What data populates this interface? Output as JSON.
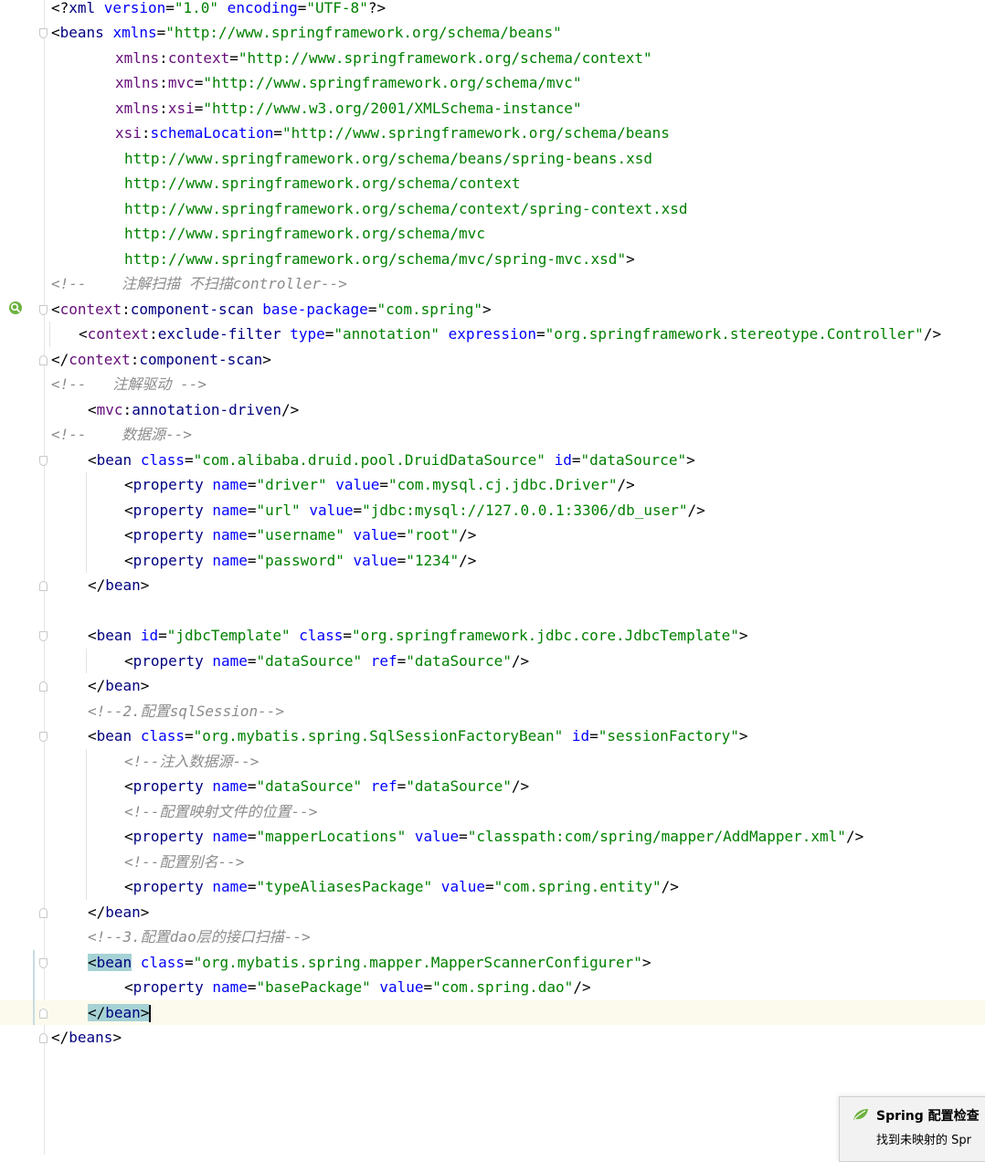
{
  "editor": {
    "language": "xml",
    "lines": [
      {
        "indent": 0,
        "fold": "",
        "tokens": [
          [
            "bracket",
            "<?"
          ],
          [
            "tag",
            "xml "
          ],
          [
            "attr",
            "version"
          ],
          [
            "eq",
            "="
          ],
          [
            "val",
            "\"1.0\""
          ],
          [
            "attr",
            " encoding"
          ],
          [
            "eq",
            "="
          ],
          [
            "val",
            "\"UTF-8\""
          ],
          [
            "bracket",
            "?>"
          ]
        ]
      },
      {
        "indent": 0,
        "fold": "open",
        "tokens": [
          [
            "bracket",
            "<"
          ],
          [
            "tag",
            "beans "
          ],
          [
            "attr",
            "xmlns"
          ],
          [
            "eq",
            "="
          ],
          [
            "val",
            "\"http://www.springframework.org/schema/beans\""
          ]
        ]
      },
      {
        "indent": 7,
        "fold": "",
        "tokens": [
          [
            "ns",
            "xmlns"
          ],
          [
            "eq",
            ":"
          ],
          [
            "ns",
            "context"
          ],
          [
            "eq",
            "="
          ],
          [
            "val",
            "\"http://www.springframework.org/schema/context\""
          ]
        ]
      },
      {
        "indent": 7,
        "fold": "",
        "tokens": [
          [
            "ns",
            "xmlns"
          ],
          [
            "eq",
            ":"
          ],
          [
            "ns",
            "mvc"
          ],
          [
            "eq",
            "="
          ],
          [
            "val",
            "\"http://www.springframework.org/schema/mvc\""
          ]
        ]
      },
      {
        "indent": 7,
        "fold": "",
        "tokens": [
          [
            "ns",
            "xmlns"
          ],
          [
            "eq",
            ":"
          ],
          [
            "ns",
            "xsi"
          ],
          [
            "eq",
            "="
          ],
          [
            "val",
            "\"http://www.w3.org/2001/XMLSchema-instance\""
          ]
        ]
      },
      {
        "indent": 7,
        "fold": "",
        "tokens": [
          [
            "ns",
            "xsi"
          ],
          [
            "eq",
            ":"
          ],
          [
            "attr",
            "schemaLocation"
          ],
          [
            "eq",
            "="
          ],
          [
            "val",
            "\"http://www.springframework.org/schema/beans"
          ]
        ]
      },
      {
        "indent": 8,
        "fold": "",
        "tokens": [
          [
            "val",
            "http://www.springframework.org/schema/beans/spring-beans.xsd"
          ]
        ]
      },
      {
        "indent": 8,
        "fold": "",
        "tokens": [
          [
            "val",
            "http://www.springframework.org/schema/context"
          ]
        ]
      },
      {
        "indent": 8,
        "fold": "",
        "tokens": [
          [
            "val",
            "http://www.springframework.org/schema/context/spring-context.xsd"
          ]
        ]
      },
      {
        "indent": 8,
        "fold": "",
        "tokens": [
          [
            "val",
            "http://www.springframework.org/schema/mvc"
          ]
        ]
      },
      {
        "indent": 8,
        "fold": "",
        "tokens": [
          [
            "val",
            "http://www.springframework.org/schema/mvc/spring-mvc.xsd\""
          ],
          [
            "bracket",
            ">"
          ]
        ]
      },
      {
        "indent": 0,
        "fold": "",
        "tokens": [
          [
            "comment",
            "<!--    注解扫描 不扫描controller-->"
          ]
        ]
      },
      {
        "indent": 0,
        "fold": "open",
        "tokens": [
          [
            "bracket",
            "<"
          ],
          [
            "ns",
            "context"
          ],
          [
            "eq",
            ":"
          ],
          [
            "tag",
            "component-scan "
          ],
          [
            "attr",
            "base-package"
          ],
          [
            "eq",
            "="
          ],
          [
            "val",
            "\"com.spring\""
          ],
          [
            "bracket",
            ">"
          ]
        ]
      },
      {
        "indent": 3,
        "fold": "",
        "tokens": [
          [
            "bracket",
            "<"
          ],
          [
            "ns",
            "context"
          ],
          [
            "eq",
            ":"
          ],
          [
            "tag",
            "exclude-filter "
          ],
          [
            "attr",
            "type"
          ],
          [
            "eq",
            "="
          ],
          [
            "val",
            "\"annotation\""
          ],
          [
            "attr",
            " expression"
          ],
          [
            "eq",
            "="
          ],
          [
            "val",
            "\"org.springframework.stereotype.Controller\""
          ],
          [
            "bracket",
            "/>"
          ]
        ]
      },
      {
        "indent": 0,
        "fold": "close",
        "tokens": [
          [
            "bracket",
            "</"
          ],
          [
            "ns",
            "context"
          ],
          [
            "eq",
            ":"
          ],
          [
            "tag",
            "component-scan"
          ],
          [
            "bracket",
            ">"
          ]
        ]
      },
      {
        "indent": 0,
        "fold": "",
        "tokens": [
          [
            "comment",
            "<!--   注解驱动 -->"
          ]
        ]
      },
      {
        "indent": 4,
        "fold": "",
        "tokens": [
          [
            "bracket",
            "<"
          ],
          [
            "ns",
            "mvc"
          ],
          [
            "eq",
            ":"
          ],
          [
            "tag",
            "annotation-driven"
          ],
          [
            "bracket",
            "/>"
          ]
        ]
      },
      {
        "indent": 0,
        "fold": "",
        "tokens": [
          [
            "comment",
            "<!--    数据源-->"
          ]
        ]
      },
      {
        "indent": 4,
        "fold": "open",
        "tokens": [
          [
            "bracket",
            "<"
          ],
          [
            "tag",
            "bean "
          ],
          [
            "attr",
            "class"
          ],
          [
            "eq",
            "="
          ],
          [
            "val",
            "\"com.alibaba.druid.pool.DruidDataSource\""
          ],
          [
            "attr",
            " id"
          ],
          [
            "eq",
            "="
          ],
          [
            "val",
            "\"dataSource\""
          ],
          [
            "bracket",
            ">"
          ]
        ]
      },
      {
        "indent": 8,
        "fold": "",
        "tokens": [
          [
            "bracket",
            "<"
          ],
          [
            "tag",
            "property "
          ],
          [
            "attr",
            "name"
          ],
          [
            "eq",
            "="
          ],
          [
            "val",
            "\"driver\""
          ],
          [
            "attr",
            " value"
          ],
          [
            "eq",
            "="
          ],
          [
            "val",
            "\"com.mysql.cj.jdbc.Driver\""
          ],
          [
            "bracket",
            "/>"
          ]
        ]
      },
      {
        "indent": 8,
        "fold": "",
        "tokens": [
          [
            "bracket",
            "<"
          ],
          [
            "tag",
            "property "
          ],
          [
            "attr",
            "name"
          ],
          [
            "eq",
            "="
          ],
          [
            "val",
            "\"url\""
          ],
          [
            "attr",
            " value"
          ],
          [
            "eq",
            "="
          ],
          [
            "val",
            "\"jdbc:mysql://127.0.0.1:3306/db_user\""
          ],
          [
            "bracket",
            "/>"
          ]
        ]
      },
      {
        "indent": 8,
        "fold": "",
        "tokens": [
          [
            "bracket",
            "<"
          ],
          [
            "tag",
            "property "
          ],
          [
            "attr",
            "name"
          ],
          [
            "eq",
            "="
          ],
          [
            "val",
            "\"username\""
          ],
          [
            "attr",
            " value"
          ],
          [
            "eq",
            "="
          ],
          [
            "val",
            "\"root\""
          ],
          [
            "bracket",
            "/>"
          ]
        ]
      },
      {
        "indent": 8,
        "fold": "",
        "tokens": [
          [
            "bracket",
            "<"
          ],
          [
            "tag",
            "property "
          ],
          [
            "attr",
            "name"
          ],
          [
            "eq",
            "="
          ],
          [
            "val",
            "\"password\""
          ],
          [
            "attr",
            " value"
          ],
          [
            "eq",
            "="
          ],
          [
            "val",
            "\"1234\""
          ],
          [
            "bracket",
            "/>"
          ]
        ]
      },
      {
        "indent": 4,
        "fold": "close",
        "tokens": [
          [
            "bracket",
            "</"
          ],
          [
            "tag",
            "bean"
          ],
          [
            "bracket",
            ">"
          ]
        ]
      },
      {
        "indent": 0,
        "fold": "",
        "tokens": []
      },
      {
        "indent": 4,
        "fold": "open",
        "tokens": [
          [
            "bracket",
            "<"
          ],
          [
            "tag",
            "bean "
          ],
          [
            "attr",
            "id"
          ],
          [
            "eq",
            "="
          ],
          [
            "val",
            "\"jdbcTemplate\""
          ],
          [
            "attr",
            " class"
          ],
          [
            "eq",
            "="
          ],
          [
            "val",
            "\"org.springframework.jdbc.core.JdbcTemplate\""
          ],
          [
            "bracket",
            ">"
          ]
        ]
      },
      {
        "indent": 8,
        "fold": "",
        "tokens": [
          [
            "bracket",
            "<"
          ],
          [
            "tag",
            "property "
          ],
          [
            "attr",
            "name"
          ],
          [
            "eq",
            "="
          ],
          [
            "val",
            "\"dataSource\""
          ],
          [
            "attr",
            " ref"
          ],
          [
            "eq",
            "="
          ],
          [
            "val",
            "\"dataSource\""
          ],
          [
            "bracket",
            "/>"
          ]
        ]
      },
      {
        "indent": 4,
        "fold": "close",
        "tokens": [
          [
            "bracket",
            "</"
          ],
          [
            "tag",
            "bean"
          ],
          [
            "bracket",
            ">"
          ]
        ]
      },
      {
        "indent": 4,
        "fold": "",
        "tokens": [
          [
            "comment",
            "<!--2.配置sqlSession-->"
          ]
        ]
      },
      {
        "indent": 4,
        "fold": "open",
        "tokens": [
          [
            "bracket",
            "<"
          ],
          [
            "tag",
            "bean "
          ],
          [
            "attr",
            "class"
          ],
          [
            "eq",
            "="
          ],
          [
            "val",
            "\"org.mybatis.spring.SqlSessionFactoryBean\""
          ],
          [
            "attr",
            " id"
          ],
          [
            "eq",
            "="
          ],
          [
            "val",
            "\"sessionFactory\""
          ],
          [
            "bracket",
            ">"
          ]
        ]
      },
      {
        "indent": 8,
        "fold": "",
        "tokens": [
          [
            "comment",
            "<!--注入数据源-->"
          ]
        ]
      },
      {
        "indent": 8,
        "fold": "",
        "tokens": [
          [
            "bracket",
            "<"
          ],
          [
            "tag",
            "property "
          ],
          [
            "attr",
            "name"
          ],
          [
            "eq",
            "="
          ],
          [
            "val",
            "\"dataSource\""
          ],
          [
            "attr",
            " ref"
          ],
          [
            "eq",
            "="
          ],
          [
            "val",
            "\"dataSource\""
          ],
          [
            "bracket",
            "/>"
          ]
        ]
      },
      {
        "indent": 8,
        "fold": "",
        "tokens": [
          [
            "comment",
            "<!--配置映射文件的位置-->"
          ]
        ]
      },
      {
        "indent": 8,
        "fold": "",
        "tokens": [
          [
            "bracket",
            "<"
          ],
          [
            "tag",
            "property "
          ],
          [
            "attr",
            "name"
          ],
          [
            "eq",
            "="
          ],
          [
            "val",
            "\"mapperLocations\""
          ],
          [
            "attr",
            " value"
          ],
          [
            "eq",
            "="
          ],
          [
            "val",
            "\"classpath:com/spring/mapper/AddMapper.xml\""
          ],
          [
            "bracket",
            "/>"
          ]
        ]
      },
      {
        "indent": 8,
        "fold": "",
        "tokens": [
          [
            "comment",
            "<!--配置别名-->"
          ]
        ]
      },
      {
        "indent": 8,
        "fold": "",
        "tokens": [
          [
            "bracket",
            "<"
          ],
          [
            "tag",
            "property "
          ],
          [
            "attr",
            "name"
          ],
          [
            "eq",
            "="
          ],
          [
            "val",
            "\"typeAliasesPackage\""
          ],
          [
            "attr",
            " value"
          ],
          [
            "eq",
            "="
          ],
          [
            "val",
            "\"com.spring.entity\""
          ],
          [
            "bracket",
            "/>"
          ]
        ]
      },
      {
        "indent": 4,
        "fold": "close",
        "tokens": [
          [
            "bracket",
            "</"
          ],
          [
            "tag",
            "bean"
          ],
          [
            "bracket",
            ">"
          ]
        ]
      },
      {
        "indent": 4,
        "fold": "",
        "tokens": [
          [
            "comment",
            "<!--3.配置dao层的接口扫描-->"
          ]
        ]
      },
      {
        "indent": 4,
        "fold": "open",
        "tokens": [
          [
            "hlbracket",
            "<"
          ],
          [
            "hltag",
            "bean"
          ],
          [
            "attr",
            " class"
          ],
          [
            "eq",
            "="
          ],
          [
            "val",
            "\"org.mybatis.spring.mapper.MapperScannerConfigurer\""
          ],
          [
            "bracket",
            ">"
          ]
        ]
      },
      {
        "indent": 8,
        "fold": "",
        "tokens": [
          [
            "bracket",
            "<"
          ],
          [
            "tag",
            "property "
          ],
          [
            "attr",
            "name"
          ],
          [
            "eq",
            "="
          ],
          [
            "val",
            "\"basePackage\""
          ],
          [
            "attr",
            " value"
          ],
          [
            "eq",
            "="
          ],
          [
            "val",
            "\"com.spring.dao\""
          ],
          [
            "bracket",
            "/>"
          ]
        ]
      },
      {
        "indent": 4,
        "fold": "close",
        "caret": true,
        "tokens": [
          [
            "hlbracket",
            "</"
          ],
          [
            "hltag",
            "bean"
          ],
          [
            "hlbracket",
            ">"
          ]
        ]
      },
      {
        "indent": 0,
        "fold": "close",
        "tokens": [
          [
            "bracket",
            "</"
          ],
          [
            "tag",
            "beans"
          ],
          [
            "bracket",
            ">"
          ]
        ]
      }
    ]
  },
  "notification": {
    "icon": "spring-leaf-icon",
    "title": "Spring 配置检查",
    "body": "找到未映射的 Spr"
  },
  "colors": {
    "tag": "#000080",
    "namespace": "#660e7a",
    "attribute": "#0000ff",
    "value": "#008000",
    "comment": "#8c8c8c",
    "caret_line": "#fcfaed",
    "tag_highlight": "#a6d2d5"
  }
}
